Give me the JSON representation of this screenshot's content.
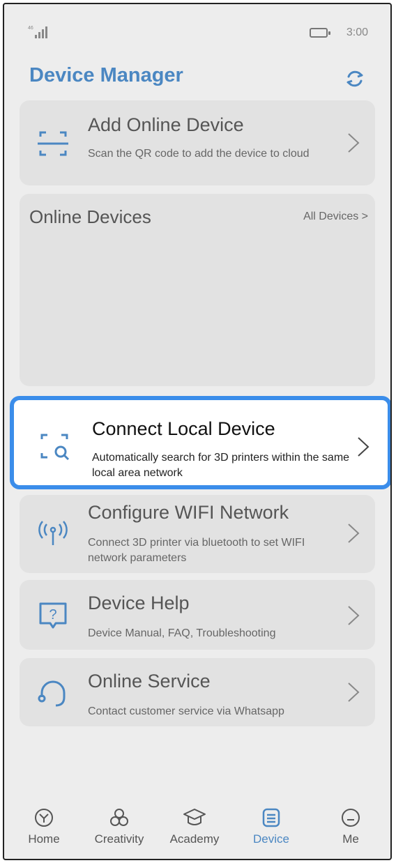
{
  "status_bar": {
    "time": "3:00"
  },
  "header": {
    "title": "Device Manager"
  },
  "cards": {
    "add_online": {
      "title": "Add Online Device",
      "subtitle": "Scan the QR code to add the device to cloud"
    },
    "online_devices": {
      "title": "Online Devices",
      "link": "All Devices >"
    },
    "connect_local": {
      "title": "Connect Local Device",
      "subtitle": "Automatically search for 3D printers within the same local area network"
    },
    "configure_wifi": {
      "title": "Configure WIFI Network",
      "subtitle": "Connect 3D printer via bluetooth to set WIFI network parameters"
    },
    "device_help": {
      "title": "Device Help",
      "subtitle": "Device Manual, FAQ, Troubleshooting"
    },
    "online_service": {
      "title": "Online Service",
      "subtitle": "Contact customer service via Whatsapp"
    }
  },
  "bottom_nav": {
    "items": [
      {
        "label": "Home",
        "icon": "home-icon"
      },
      {
        "label": "Creativity",
        "icon": "creativity-icon"
      },
      {
        "label": "Academy",
        "icon": "academy-icon"
      },
      {
        "label": "Device",
        "icon": "device-icon",
        "active": true
      },
      {
        "label": "Me",
        "icon": "me-icon"
      }
    ]
  },
  "colors": {
    "accent": "#4b87c2",
    "highlight_border": "#3b8dea"
  }
}
